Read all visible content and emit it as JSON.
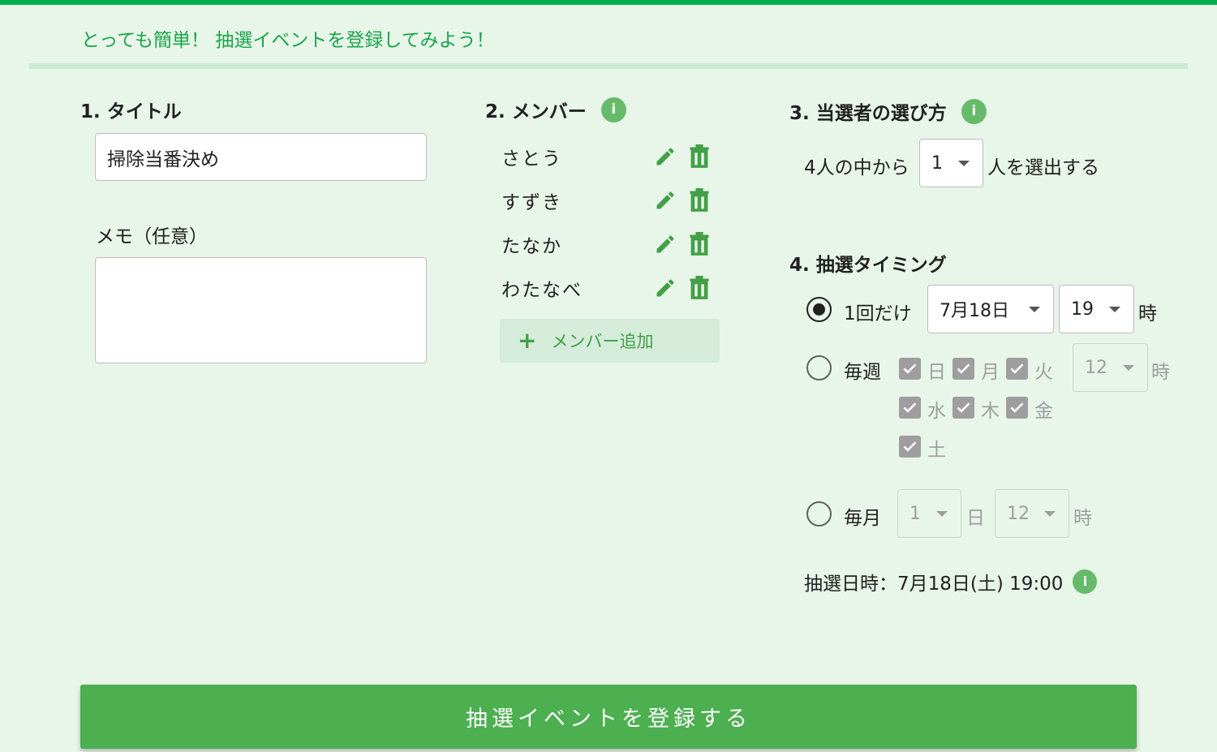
{
  "header": {
    "headline": "とっても簡単！ 抽選イベントを登録してみよう！"
  },
  "title_section": {
    "heading": "1. タイトル",
    "title_value": "掃除当番決め",
    "memo_label": "メモ（任意）",
    "memo_value": ""
  },
  "members_section": {
    "heading": "2. メンバー",
    "members": [
      {
        "name": "さとう"
      },
      {
        "name": "すずき"
      },
      {
        "name": "たなか"
      },
      {
        "name": "わたなべ"
      }
    ],
    "add_label": "メンバー追加",
    "add_icon": "+"
  },
  "selection_section": {
    "heading": "3. 当選者の選び方",
    "prefix": "4人の中から",
    "count": "1",
    "suffix": "人を選出する"
  },
  "timing_section": {
    "heading": "4. 抽選タイミング",
    "once": {
      "label": "1回だけ",
      "date": "7月18日",
      "hour": "19",
      "hour_unit": "時",
      "selected": true
    },
    "weekly": {
      "label": "毎週",
      "days": [
        "日",
        "月",
        "火",
        "水",
        "木",
        "金",
        "土"
      ],
      "hour": "12",
      "hour_unit": "時"
    },
    "monthly": {
      "label": "毎月",
      "day": "1",
      "day_unit": "日",
      "hour": "12",
      "hour_unit": "時"
    },
    "summary": "抽選日時：7月18日(土) 19:00"
  },
  "submit_label": "抽選イベントを登録する",
  "info_icon_text": "i",
  "colors": {
    "brand": "#00b050",
    "accent": "#4caf50",
    "icon": "#43a047",
    "info": "#66bb6a"
  }
}
